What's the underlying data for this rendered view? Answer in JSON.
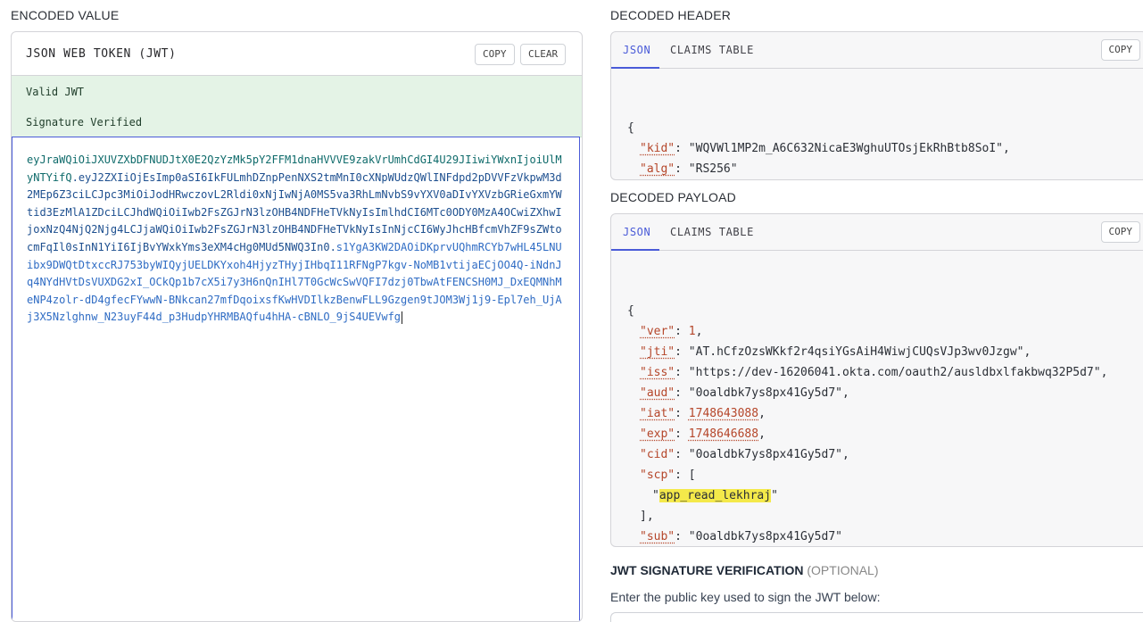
{
  "encoded": {
    "section_title": "ENCODED VALUE",
    "panel_title": "JSON WEB TOKEN (JWT)",
    "copy_label": "COPY",
    "clear_label": "CLEAR",
    "status_valid": "Valid JWT",
    "status_signature": "Signature Verified",
    "token_header": "eyJraWQiOiJXUVZXbDFNUDJtX0E2QzYzMk5pY2FFM1dnaHVVVE9zakVrUmhCdGI4U29JIiwiYWxnIjoiUlMyNTYifQ",
    "token_payload": "eyJ2ZXIiOjEsImp0aSI6IkFULmhDZnpPenNXS2tmMnI0cXNpWUdzQWlINFdpd2pDVVFzVkpwM3d2MEp6Z3ciLCJpc3MiOiJodHRwczovL2Rldi0xNjIwNjA0MS5va3RhLmNvbS9vYXV0aDIvYXVzbGRieGxmYWtid3EzMlA1ZDciLCJhdWQiOiIwb2FsZGJrN3lzOHB4NDFHeTVkNyIsImlhdCI6MTc0ODY0MzA4OCwiZXhwIjoxNzQ4NjQ2Njg4LCJjaWQiOiIwb2FsZGJrN3lzOHB4NDFHeTVkNyIsInNjcCI6WyJhcHBfcmVhZF9sZWtocmFqIl0sInN1YiI6IjBvYWxkYms3eXM4cHg0MUd5NWQ3In0",
    "token_signature": "s1YgA3KW2DAOiDKprvUQhmRCYb7wHL45LNUibx9DWQtDtxccRJ753byWIQyjUELDKYxoh4HjyzTHyjIHbqI11RFNgP7kgv-NoMB1vtijaECjOO4Q-iNdnJq4NYdHVtDsVUXDG2xI_OCkQp1b7cX5i7y3H6nQnIHl7T0GcWcSwVQFI7dzj0TbwAtFENCSH0MJ_DxEQMNhMeNP4zolr-dD4gfecFYwwN-BNkcan27mfDqoixsfKwHVDIlkzBenwFLL9Gzgen9tJOM3Wj1j9-Epl7eh_UjAj3X5Nzlghnw_N23uyF44d_p3HudpYHRMBAQfu4hHA-cBNLO_9jS4UEVwfg"
  },
  "header": {
    "section_title": "DECODED HEADER",
    "tab_json": "JSON",
    "tab_claims": "CLAIMS TABLE",
    "copy_label": "COPY",
    "kid": "\"WQVWl1MP2m_A6C632NicaE3WghuUTOsjEkRhBtb8SoI\"",
    "alg": "\"RS256\""
  },
  "payload": {
    "section_title": "DECODED PAYLOAD",
    "tab_json": "JSON",
    "tab_claims": "CLAIMS TABLE",
    "copy_label": "COPY",
    "ver": "1",
    "jti": "\"AT.hCfzOzsWKkf2r4qsiYGsAiH4WiwjCUQsVJp3wv0Jzgw\"",
    "iss": "\"https://dev-16206041.okta.com/oauth2/ausldbxlfakbwq32P5d7\"",
    "aud": "\"0oaldbk7ys8px41Gy5d7\"",
    "iat": "1748643088",
    "exp": "1748646688",
    "cid": "\"0oaldbk7ys8px41Gy5d7\"",
    "scp_item": "app_read_lekhraj",
    "sub": "\"0oaldbk7ys8px41Gy5d7\""
  },
  "signature_section": {
    "title": "JWT SIGNATURE VERIFICATION",
    "optional": "(OPTIONAL)",
    "description": "Enter the public key used to sign the JWT below:"
  }
}
